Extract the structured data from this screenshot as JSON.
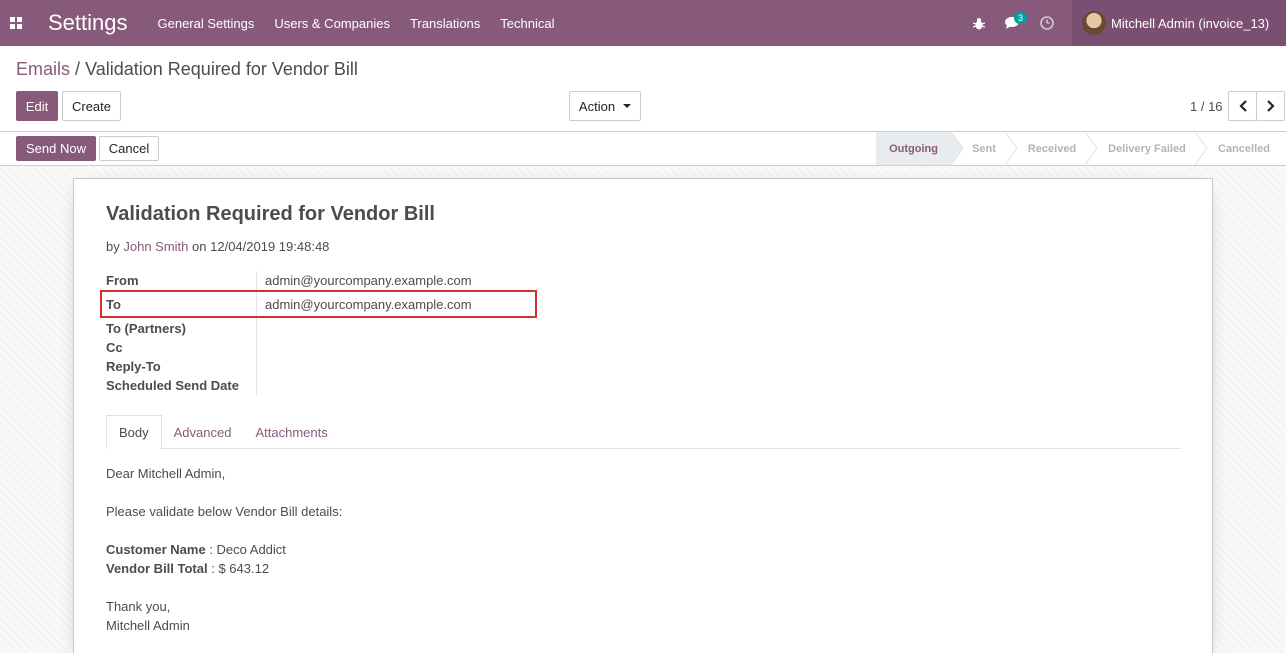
{
  "navbar": {
    "brand": "Settings",
    "menu": [
      "General Settings",
      "Users & Companies",
      "Translations",
      "Technical"
    ],
    "messages_count": "3",
    "user_name": "Mitchell Admin (invoice_13)",
    "icons": [
      "apps-grid-icon",
      "bug-icon",
      "chat-icon",
      "clock-icon"
    ]
  },
  "breadcrumb": {
    "parent": "Emails",
    "separator": "/",
    "current": "Validation Required for Vendor Bill"
  },
  "toolbar": {
    "edit": "Edit",
    "create": "Create",
    "action": "Action",
    "pager": "1 / 16"
  },
  "statusbar": {
    "send_now": "Send Now",
    "cancel": "Cancel",
    "stages": [
      "Outgoing",
      "Sent",
      "Received",
      "Delivery Failed",
      "Cancelled"
    ],
    "active_stage": "Outgoing"
  },
  "mail": {
    "subject": "Validation Required for Vendor Bill",
    "by_prefix": "by",
    "author": "John Smith",
    "on_prefix": "on",
    "date": "12/04/2019 19:48:48",
    "fields": [
      {
        "label": "From",
        "value": "admin@yourcompany.example.com"
      },
      {
        "label": "To",
        "value": "admin@yourcompany.example.com"
      },
      {
        "label": "To (Partners)",
        "value": ""
      },
      {
        "label": "Cc",
        "value": ""
      },
      {
        "label": "Reply-To",
        "value": ""
      },
      {
        "label": "Scheduled Send Date",
        "value": ""
      }
    ],
    "tabs": [
      "Body",
      "Advanced",
      "Attachments"
    ],
    "active_tab": "Body",
    "body": {
      "greeting": "Dear Mitchell Admin,",
      "intro": "Please validate below Vendor Bill details:",
      "customer_label": "Customer Name",
      "customer_value": " : Deco Addict",
      "total_label": "Vendor Bill Total",
      "total_value": " : $ 643.12",
      "thanks": "Thank you,",
      "signature": "Mitchell Admin"
    }
  },
  "colors": {
    "brand": "#875a7b",
    "highlight": "#d32f2f"
  }
}
